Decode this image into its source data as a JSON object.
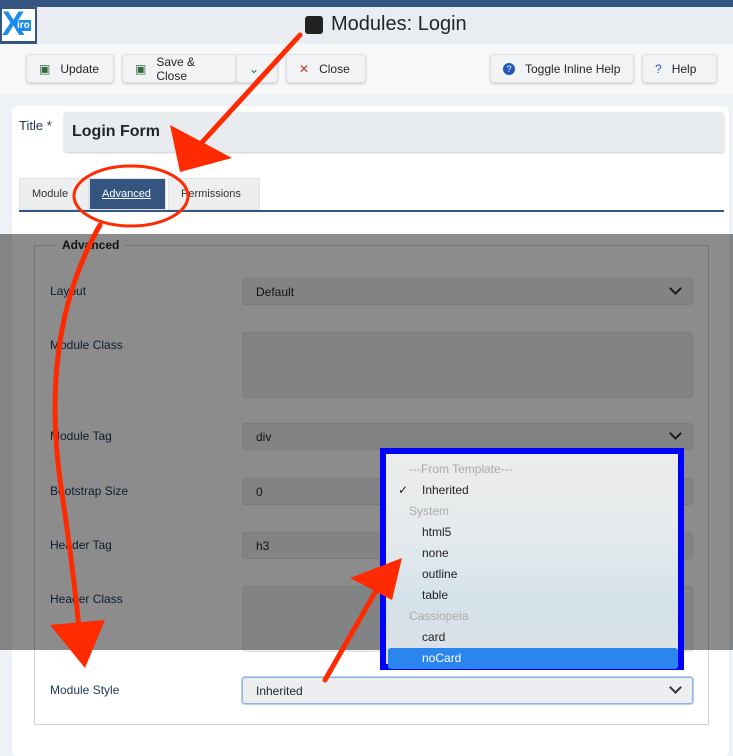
{
  "header": {
    "logo_text": "Xiro",
    "title": "Modules: Login"
  },
  "toolbar": {
    "update": "Update",
    "save_close": "Save & Close",
    "close": "Close",
    "toggle_help": "Toggle Inline Help",
    "help": "Help"
  },
  "form": {
    "title_label": "Title *",
    "title_value": "Login Form",
    "tabs": [
      "Module",
      "Advanced",
      "Permissions"
    ],
    "legend": "Advanced",
    "fields": {
      "layout": {
        "label": "Layout",
        "value": "Default"
      },
      "module_class": {
        "label": "Module Class",
        "value": ""
      },
      "module_tag": {
        "label": "Module Tag",
        "value": "div"
      },
      "bootstrap_size": {
        "label": "Bootstrap Size",
        "value": "0"
      },
      "header_tag": {
        "label": "Header Tag",
        "value": "h3"
      },
      "header_class": {
        "label": "Header Class",
        "value": ""
      },
      "module_style": {
        "label": "Module Style",
        "value": "Inherited"
      }
    }
  },
  "dropdown": {
    "options": [
      {
        "label": "---From Template---",
        "group": true
      },
      {
        "label": "Inherited",
        "checked": true
      },
      {
        "label": "System",
        "group": true
      },
      {
        "label": "html5"
      },
      {
        "label": "none"
      },
      {
        "label": "outline"
      },
      {
        "label": "table"
      },
      {
        "label": "Cassiopeia",
        "group": true
      },
      {
        "label": "card"
      },
      {
        "label": "noCard",
        "highlighted": true
      }
    ]
  },
  "colors": {
    "brand": "#34557f",
    "annotation": "#ff2a00",
    "highlight_box": "#0000ff",
    "selected_option": "#2a86ee"
  }
}
